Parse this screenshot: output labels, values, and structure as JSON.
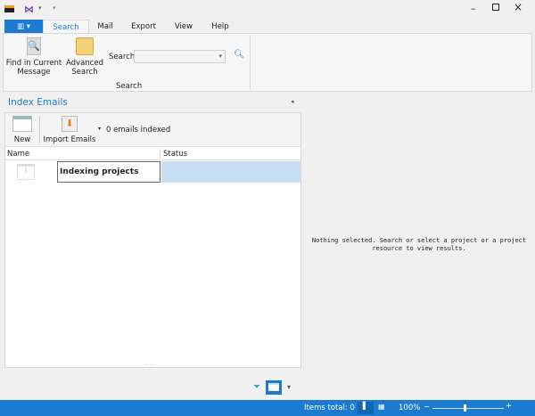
{
  "titlebar": {
    "icons": [
      "mail-app-icon",
      "visual-studio-icon",
      "quick-access-dropdown-icon"
    ],
    "controls": [
      "minimize",
      "maximize",
      "close"
    ]
  },
  "tabs": [
    {
      "label": "Search",
      "active": true
    },
    {
      "label": "Mail"
    },
    {
      "label": "Export"
    },
    {
      "label": "View"
    },
    {
      "label": "Help"
    }
  ],
  "ribbon": {
    "find_current": "Find in Current\nMessage",
    "advanced": "Advanced\nSearch",
    "search_label": "Search",
    "search_value": "",
    "group_label": "Search"
  },
  "panel": {
    "title": "Index Emails",
    "new_label": "New",
    "import_label": "Import Emails",
    "indexed": "0 emails indexed",
    "columns": [
      "Name",
      "Status"
    ],
    "rows": [
      {
        "name": "Indexing projects",
        "status": ""
      }
    ]
  },
  "right": {
    "message": "Nothing selected. Search or select a project or a project resource to view results."
  },
  "status": {
    "items_total": "Items total: 0",
    "zoom": "100%",
    "zoom_level": 100
  },
  "colors": {
    "accent": "#1a7bd0",
    "title": "#1a7bd0",
    "selected": "#c9ddf3"
  }
}
